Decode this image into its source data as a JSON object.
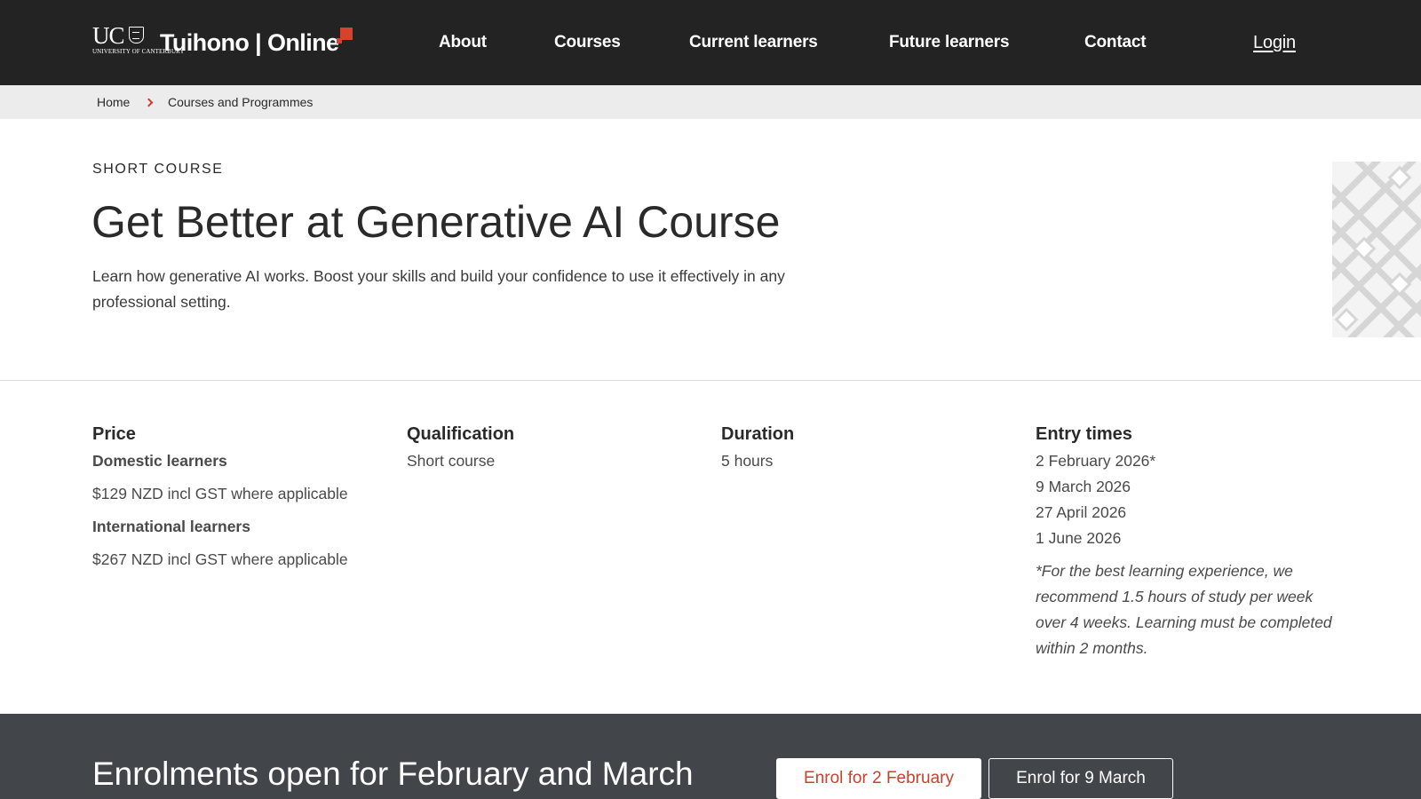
{
  "header": {
    "logo_letters": "UC",
    "logo_sub": "UNIVERSITY OF CANTERBURY",
    "brand": "Tuihono | Online",
    "nav": [
      "About",
      "Courses",
      "Current learners",
      "Future learners",
      "Contact"
    ],
    "login": "Login"
  },
  "breadcrumb": {
    "home": "Home",
    "current": "Courses and Programmes"
  },
  "hero": {
    "eyebrow": "SHORT COURSE",
    "title": "Get Better at Generative AI Course",
    "lead": "Learn how generative AI works. Boost your skills and build your confidence to use it effectively in any professional setting."
  },
  "details": {
    "price": {
      "heading": "Price",
      "domestic_label": "Domestic learners",
      "domestic_value": "$129 NZD incl GST where applicable",
      "international_label": "International learners",
      "international_value": "$267 NZD incl GST where applicable"
    },
    "qualification": {
      "heading": "Qualification",
      "value": "Short course"
    },
    "duration": {
      "heading": "Duration",
      "value": "5 hours"
    },
    "entry": {
      "heading": "Entry times",
      "dates": [
        "2 February 2026*",
        "9 March 2026",
        "27 April 2026",
        "1 June 2026"
      ],
      "note": "*For the best learning experience, we recommend 1.5 hours of study per week over 4 weeks. Learning must be completed within 2 months."
    }
  },
  "banner": {
    "title": "Enrolments open for February and March",
    "btn_feb": "Enrol for 2 February",
    "btn_mar": "Enrol for 9 March"
  },
  "colors": {
    "header_bg": "#232323",
    "accent": "#d9412f",
    "banner_bg": "#42464b"
  }
}
